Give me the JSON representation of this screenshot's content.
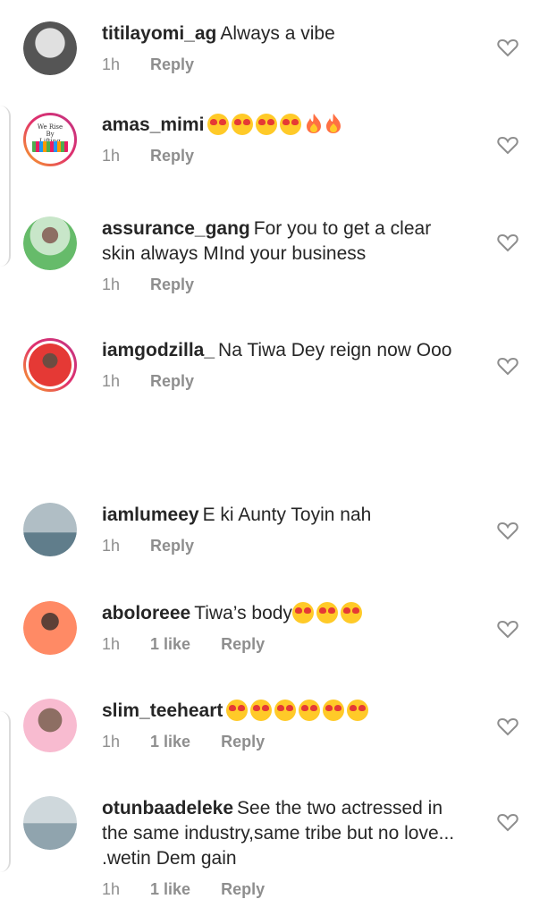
{
  "comments": [
    {
      "username": "titilayomi_ag",
      "text": "Always a vibe",
      "time": "1h",
      "likes": "",
      "reply": "Reply",
      "hearts": 0,
      "fire": 0
    },
    {
      "username": "amas_mimi",
      "text": "",
      "time": "1h",
      "likes": "",
      "reply": "Reply",
      "hearts": 4,
      "fire": 2,
      "avatar_text": "We Rise By Lifting Others"
    },
    {
      "username": "assurance_gang",
      "text": "For you to get a clear skin always MInd your business",
      "time": "1h",
      "likes": "",
      "reply": "Reply",
      "hearts": 0,
      "fire": 0
    },
    {
      "username": "iamgodzilla_",
      "text": "Na Tiwa Dey reign now Ooo",
      "time": "1h",
      "likes": "",
      "reply": "Reply",
      "hearts": 0,
      "fire": 0
    },
    {
      "username": "iamlumeey",
      "text": "E ki Aunty Toyin nah",
      "time": "1h",
      "likes": "",
      "reply": "Reply",
      "hearts": 0,
      "fire": 0
    },
    {
      "username": "aboloreee",
      "text": "Tiwa’s body",
      "time": "1h",
      "likes": "1 like",
      "reply": "Reply",
      "hearts": 3,
      "fire": 0
    },
    {
      "username": "slim_teeheart",
      "text": "",
      "time": "1h",
      "likes": "1 like",
      "reply": "Reply",
      "hearts": 6,
      "fire": 0
    },
    {
      "username": "otunbaadeleke",
      "text": "See the two actressed in the same industry,same tribe but no love... .wetin Dem gain",
      "time": "1h",
      "likes": "1 like",
      "reply": "Reply",
      "hearts": 0,
      "fire": 0
    }
  ],
  "icons": {
    "like": "heart-outline-icon",
    "heart_eyes": "smiling-face-with-heart-eyes-emoji",
    "fire": "fire-emoji"
  },
  "colors": {
    "text": "#262626",
    "meta": "#8e8e8e",
    "heart_outline": "#8e8e8e"
  }
}
